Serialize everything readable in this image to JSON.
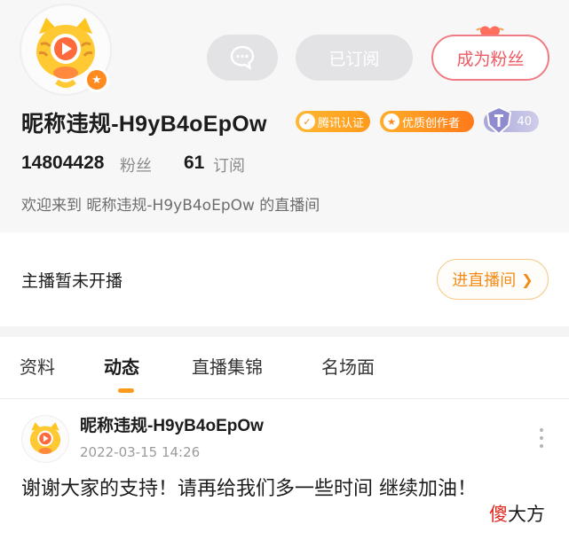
{
  "profile": {
    "nickname": "昵称违规-H9yB4oEpOw",
    "avatar_icon": "tiger-mascot-icon",
    "avatar_badge_icon": "star-icon",
    "fans_count": "14804428",
    "fans_label": "粉丝",
    "subscriptions_count": "61",
    "subscriptions_label": "订阅",
    "welcome_text": "欢迎来到 昵称违规-H9yB4oEpOw 的直播间",
    "badges": {
      "verify": "腾讯认证",
      "creator": "优质创作者",
      "level": "40"
    }
  },
  "actions": {
    "message_icon": "chat-bubble-icon",
    "subscribe_label": "已订阅",
    "become_fan_label": "成为粉丝"
  },
  "live": {
    "status_text": "主播暂未开播",
    "enter_label": "进直播间",
    "enter_icon": "chevron-right-icon"
  },
  "tabs": [
    {
      "label": "资料",
      "active": false
    },
    {
      "label": "动态",
      "active": true
    },
    {
      "label": "直播集锦",
      "active": false
    },
    {
      "label": "名场面",
      "active": false
    }
  ],
  "post": {
    "author": "昵称违规-H9yB4oEpOw",
    "timestamp": "2022-03-15 14:26",
    "content": "谢谢大家的支持！请再给我们多一些时间 继续加油！",
    "more_icon": "more-vertical-icon"
  },
  "watermark": {
    "part1": "傻",
    "part2": "大方"
  },
  "colors": {
    "accent_orange": "#ff9b1a",
    "fan_pink": "#ee5a64",
    "background_gray": "#f7f7f8"
  }
}
